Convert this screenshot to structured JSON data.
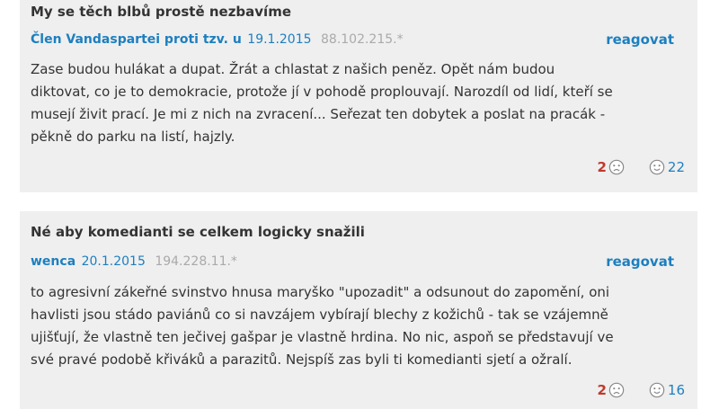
{
  "comments": [
    {
      "title": "My se těch blbů prostě nezbavíme",
      "author": "Člen Vandaspartei proti tzv. u",
      "date": "19.1.2015",
      "ip": "88.102.215.*",
      "reply_label": "reagovat",
      "lines": [
        "Zase budou hulákat a dupat. Žrát a chlastat z našich peněz. Opět nám budou",
        "diktovat, co je to demokracie, protože jí v pohodě proplouvají. Narozdíl od lidí, kteří se",
        "musejí živit prací. Je mi z nich na zvracení... Seřezat ten dobytek a poslat na pracák -",
        "pěkně do parku na listí, hajzly."
      ],
      "votes_negative": "2",
      "votes_positive": "22"
    },
    {
      "title": "Né aby komedianti se celkem logicky snažili",
      "author": "wenca",
      "date": "20.1.2015",
      "ip": "194.228.11.*",
      "reply_label": "reagovat",
      "lines": [
        "to agresivní zákeřné svinstvo hnusa maryško \"upozadit\" a odsunout do zapomění, oni",
        "havlisti jsou stádo paviánů co si navzájem vybírají blechy z kožichů - tak se vzájemně",
        "ujišťují, že vlastně ten ječivej gašpar je vlastně hrdina. No nic, aspoň se představují ve",
        "své pravé podobě křiváků a parazitů. Nejspíš zas byli ti komedianti sjetí a ožralí."
      ],
      "votes_negative": "2",
      "votes_positive": "16"
    }
  ],
  "icons": {
    "negative": "sad-face-icon",
    "positive": "smile-face-icon"
  },
  "colors": {
    "link": "#1d7fbf",
    "negative": "#c0392b",
    "muted": "#aaaaaa",
    "card": "#efefef"
  }
}
